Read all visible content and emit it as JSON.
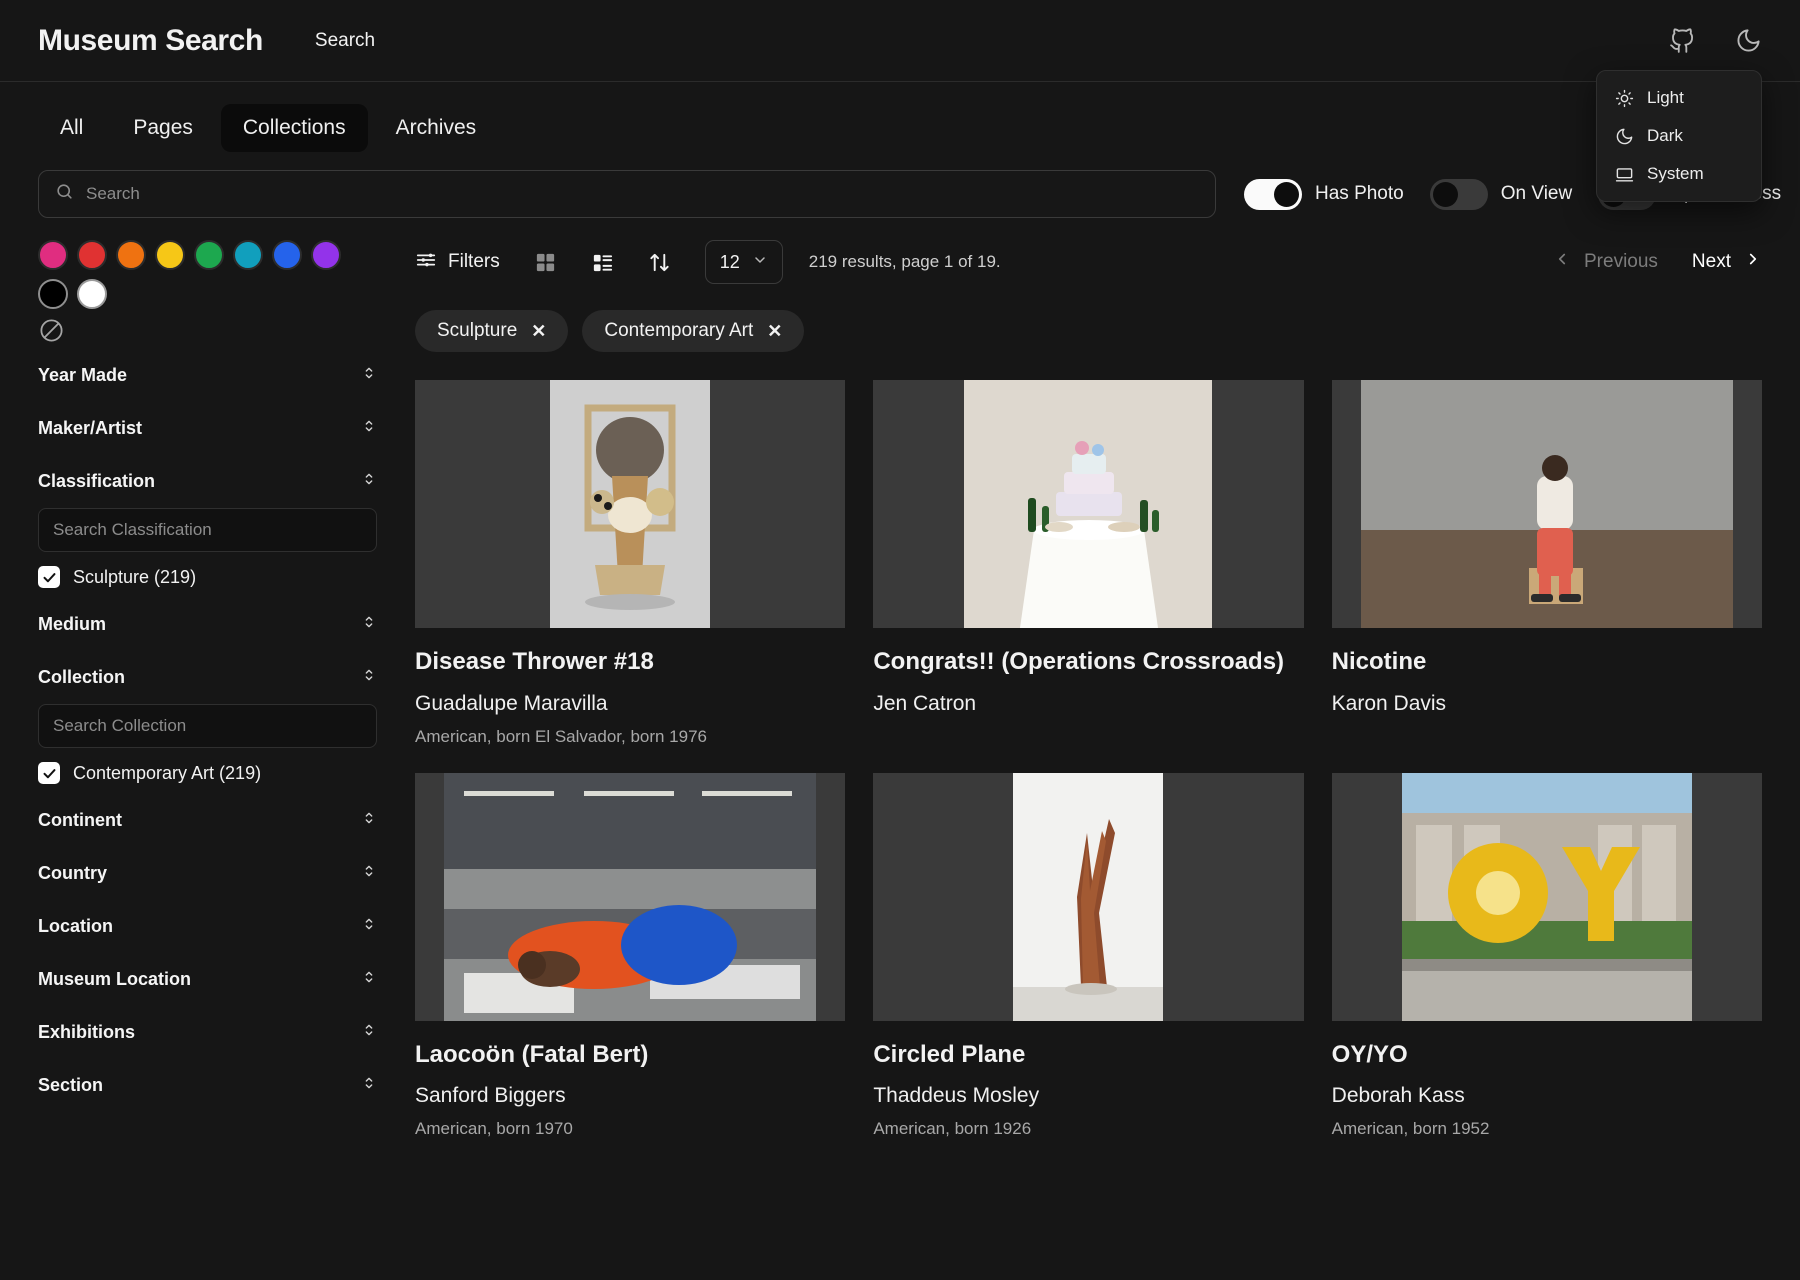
{
  "header": {
    "brand": "Museum Search",
    "nav_link": "Search",
    "github_icon": "github-icon",
    "theme_icon": "moon-icon"
  },
  "theme_menu": {
    "items": [
      {
        "label": "Light",
        "icon": "sun-icon"
      },
      {
        "label": "Dark",
        "icon": "moon-icon"
      },
      {
        "label": "System",
        "icon": "laptop-icon"
      }
    ]
  },
  "tabs": [
    {
      "label": "All",
      "active": false
    },
    {
      "label": "Pages",
      "active": false
    },
    {
      "label": "Collections",
      "active": true
    },
    {
      "label": "Archives",
      "active": false
    }
  ],
  "search": {
    "placeholder": "Search",
    "value": "",
    "icon": "search-icon"
  },
  "toggles": [
    {
      "label": "Has Photo",
      "state": "on"
    },
    {
      "label": "On View",
      "state": "off"
    },
    {
      "label": "Open Access",
      "state": "off"
    }
  ],
  "sidebar": {
    "colors": [
      {
        "name": "pink",
        "hex": "#e02d80"
      },
      {
        "name": "red",
        "hex": "#e03232"
      },
      {
        "name": "orange",
        "hex": "#ef7211"
      },
      {
        "name": "yellow",
        "hex": "#f6c717"
      },
      {
        "name": "green",
        "hex": "#1da84f"
      },
      {
        "name": "teal",
        "hex": "#119fbd"
      },
      {
        "name": "blue",
        "hex": "#2563eb"
      },
      {
        "name": "purple",
        "hex": "#9333ea"
      },
      {
        "name": "black",
        "hex": "#000000"
      },
      {
        "name": "white",
        "hex": "#ffffff"
      }
    ],
    "no_color_icon": "no-color-icon",
    "facets": [
      {
        "label": "Year Made"
      },
      {
        "label": "Maker/Artist"
      },
      {
        "label": "Classification",
        "search_placeholder": "Search Classification",
        "option": {
          "label": "Sculpture (219)",
          "checked": true
        }
      },
      {
        "label": "Medium"
      },
      {
        "label": "Collection",
        "search_placeholder": "Search Collection",
        "option": {
          "label": "Contemporary Art (219)",
          "checked": true
        }
      },
      {
        "label": "Continent"
      },
      {
        "label": "Country"
      },
      {
        "label": "Location"
      },
      {
        "label": "Museum Location"
      },
      {
        "label": "Exhibitions"
      },
      {
        "label": "Section"
      }
    ]
  },
  "toolbar": {
    "filters_label": "Filters",
    "filters_icon": "sliders-icon",
    "grid_view_icon": "grid-view-icon",
    "list_view_icon": "list-view-icon",
    "sort_icon": "sort-arrows-icon",
    "page_size": "12",
    "page_size_chevron": "chevron-down-icon",
    "results_text": "219 results, page 1 of 19.",
    "previous_label": "Previous",
    "next_label": "Next"
  },
  "chips": [
    {
      "label": "Sculpture",
      "remove": "✕"
    },
    {
      "label": "Contemporary Art",
      "remove": "✕"
    }
  ],
  "results": [
    {
      "title": "Disease Thrower #18",
      "artist": "Guadalupe Maravilla",
      "bio": "American, born El Salvador, born 1976",
      "image": "assemblage-sculpture-photo"
    },
    {
      "title": "Congrats!! (Operations Crossroads)",
      "artist": "Jen Catron",
      "bio": "",
      "image": "cake-table-installation-photo"
    },
    {
      "title": "Nicotine",
      "artist": "Karon Davis",
      "bio": "",
      "image": "seated-figure-gallery-photo"
    },
    {
      "title": "Laocoön (Fatal Bert)",
      "artist": "Sanford Biggers",
      "bio": "American, born 1970",
      "image": "inflatable-figure-warehouse-photo"
    },
    {
      "title": "Circled Plane",
      "artist": "Thaddeus Mosley",
      "bio": "American, born 1926",
      "image": "carved-wood-sculpture-photo"
    },
    {
      "title": "OY/YO",
      "artist": "Deborah Kass",
      "bio": "American, born 1952",
      "image": "yellow-oyyo-outdoor-sculpture-photo"
    }
  ]
}
